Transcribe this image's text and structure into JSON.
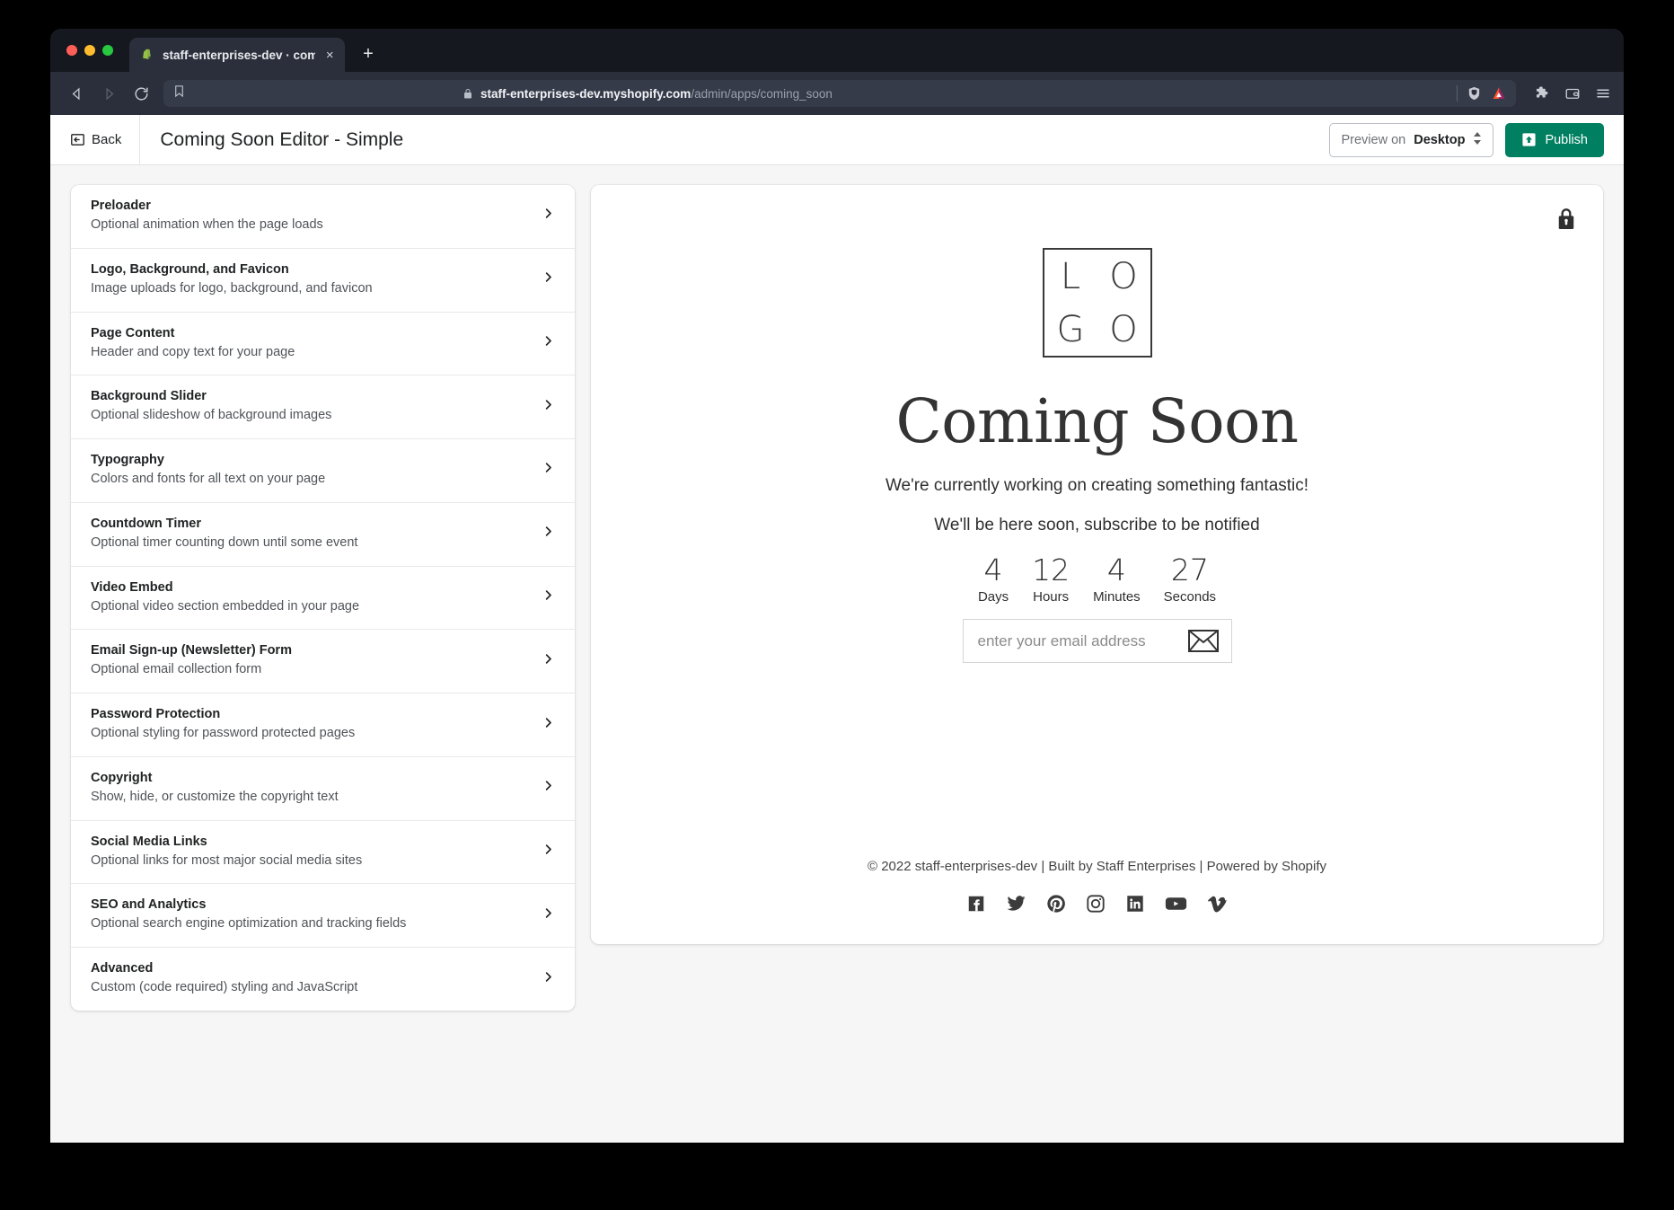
{
  "browser": {
    "tab": {
      "title": "staff-enterprises-dev · coming_",
      "favicon": "shopify-bag-icon",
      "close_label": "×"
    },
    "new_tab_label": "+",
    "nav": {
      "back_icon": "back-arrow-icon",
      "forward_icon": "forward-arrow-icon",
      "reload_icon": "reload-icon",
      "bookmark_icon": "bookmark-icon"
    },
    "url": {
      "lock_icon": "lock-icon",
      "domain": "staff-enterprises-dev.myshopify.com",
      "path": "/admin/apps/coming_soon",
      "shield_icon": "brave-shield-icon",
      "rewards_icon": "brave-rewards-icon"
    },
    "toolbar_right": {
      "extensions_icon": "puzzle-icon",
      "wallet_icon": "wallet-icon",
      "menu_icon": "hamburger-menu-icon"
    }
  },
  "header": {
    "back_label": "Back",
    "back_icon": "back-boxed-arrow-icon",
    "title": "Coming Soon Editor - Simple",
    "preview_select": {
      "prefix": "Preview on",
      "value": "Desktop",
      "caret": "⇅"
    },
    "publish": {
      "label": "Publish",
      "icon": "publish-upload-icon",
      "color": "#008060"
    }
  },
  "settings": {
    "items": [
      {
        "title": "Preloader",
        "desc": "Optional animation when the page loads"
      },
      {
        "title": "Logo, Background, and Favicon",
        "desc": "Image uploads for logo, background, and favicon"
      },
      {
        "title": "Page Content",
        "desc": "Header and copy text for your page"
      },
      {
        "title": "Background Slider",
        "desc": "Optional slideshow of background images"
      },
      {
        "title": "Typography",
        "desc": "Colors and fonts for all text on your page"
      },
      {
        "title": "Countdown Timer",
        "desc": "Optional timer counting down until some event"
      },
      {
        "title": "Video Embed",
        "desc": "Optional video section embedded in your page"
      },
      {
        "title": "Email Sign-up (Newsletter) Form",
        "desc": "Optional email collection form"
      },
      {
        "title": "Password Protection",
        "desc": "Optional styling for password protected pages"
      },
      {
        "title": "Copyright",
        "desc": "Show, hide, or customize the copyright text"
      },
      {
        "title": "Social Media Links",
        "desc": "Optional links for most major social media sites"
      },
      {
        "title": "SEO and Analytics",
        "desc": "Optional search engine optimization and tracking fields"
      },
      {
        "title": "Advanced",
        "desc": "Custom (code required) styling and JavaScript"
      }
    ]
  },
  "preview": {
    "lock_icon": "padlock-icon",
    "logo": {
      "line1": [
        "L",
        "O"
      ],
      "line2": [
        "G",
        "O"
      ]
    },
    "heading": "Coming Soon",
    "lead_1": "We're currently working on creating something fantastic!",
    "lead_2": "We'll be here soon, subscribe to be notified",
    "countdown": [
      {
        "value": "4",
        "label": "Days"
      },
      {
        "value": "12",
        "label": "Hours"
      },
      {
        "value": "4",
        "label": "Minutes"
      },
      {
        "value": "27",
        "label": "Seconds"
      }
    ],
    "email_form": {
      "placeholder": "enter your email address",
      "submit_icon": "envelope-icon"
    },
    "copyright": "© 2022 staff-enterprises-dev | Built by Staff Enterprises | Powered by Shopify",
    "social": [
      {
        "name": "facebook"
      },
      {
        "name": "twitter"
      },
      {
        "name": "pinterest"
      },
      {
        "name": "instagram"
      },
      {
        "name": "linkedin"
      },
      {
        "name": "youtube"
      },
      {
        "name": "vimeo"
      }
    ]
  }
}
